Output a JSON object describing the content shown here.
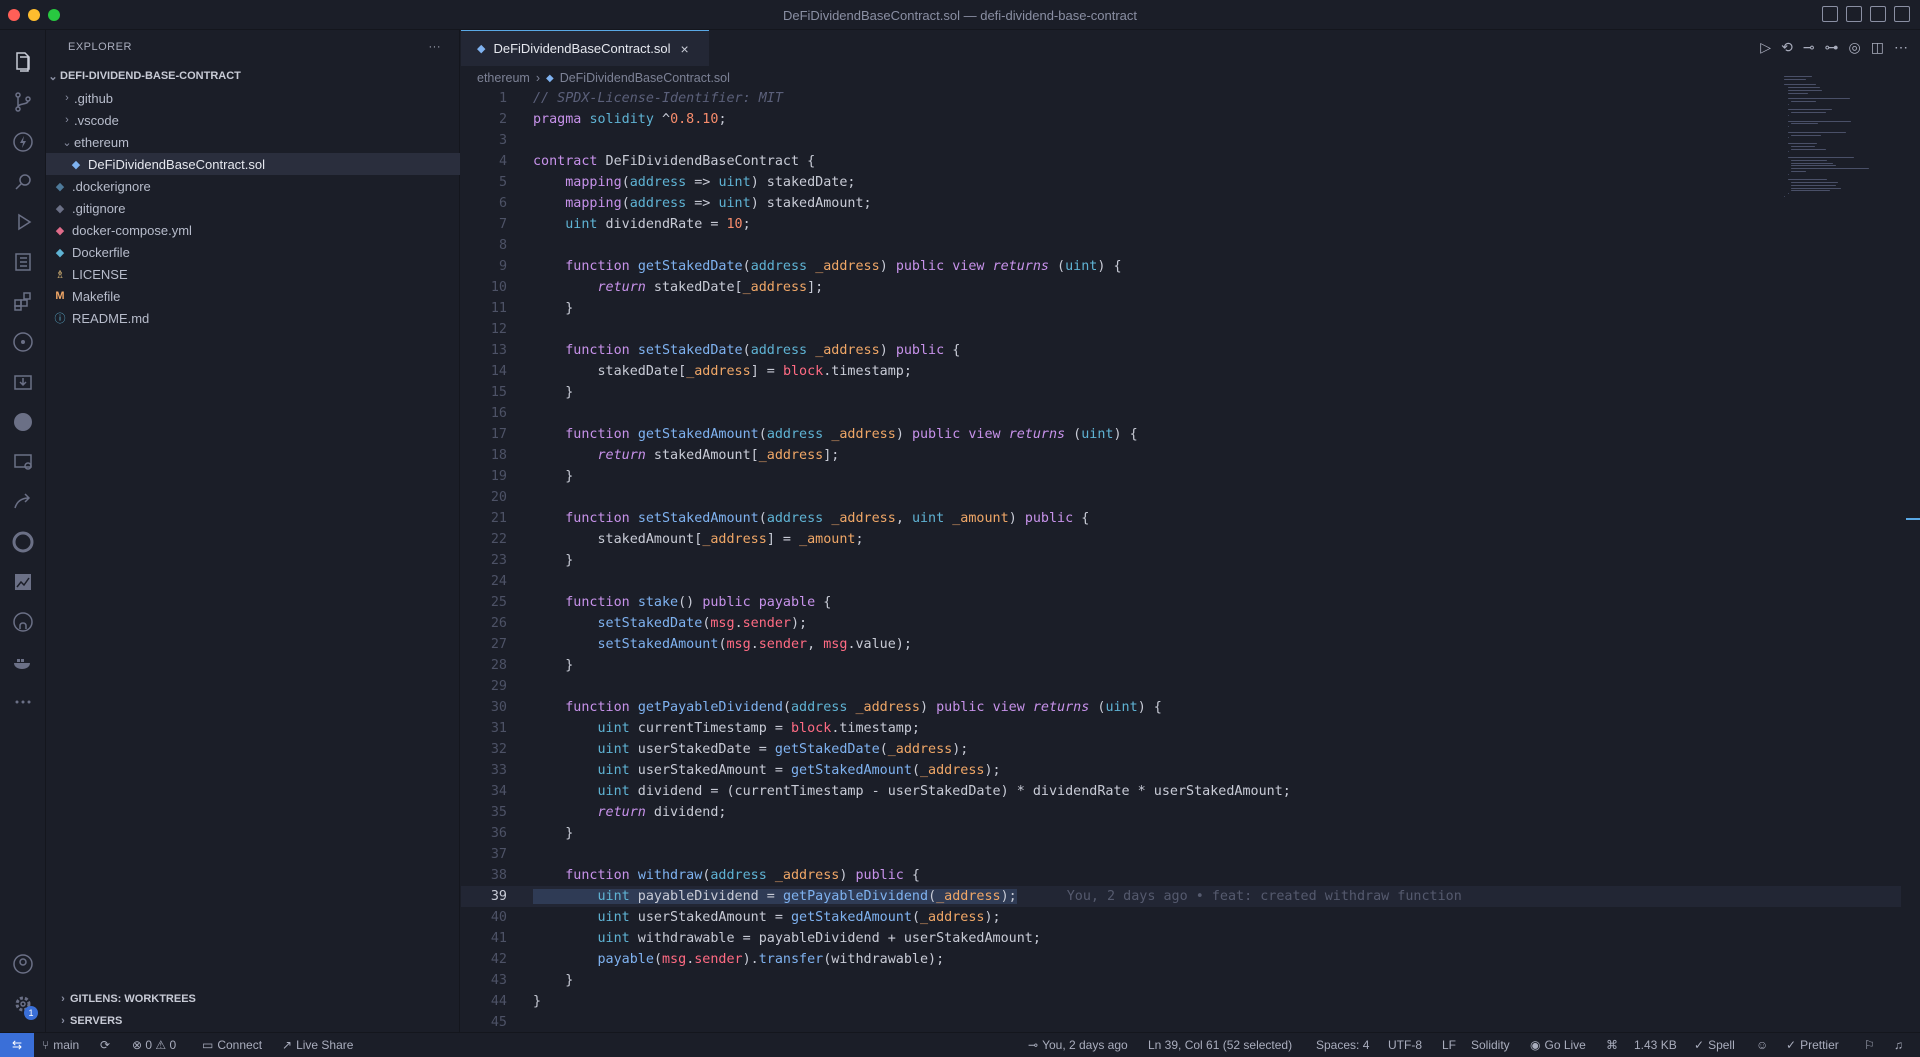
{
  "window": {
    "title": "DeFiDividendBaseContract.sol — defi-dividend-base-contract"
  },
  "explorer": {
    "header": "EXPLORER",
    "more": "···",
    "project": "DEFI-DIVIDEND-BASE-CONTRACT",
    "items": [
      {
        "label": ".github",
        "chev": "›"
      },
      {
        "label": ".vscode",
        "chev": "›"
      },
      {
        "label": "ethereum",
        "chev": "⌄"
      },
      {
        "label": "DeFiDividendBaseContract.sol",
        "icon": "◆"
      },
      {
        "label": ".dockerignore",
        "icon": "◆"
      },
      {
        "label": ".gitignore",
        "icon": "◆"
      },
      {
        "label": "docker-compose.yml",
        "icon": "◆"
      },
      {
        "label": "Dockerfile",
        "icon": "◆"
      },
      {
        "label": "LICENSE",
        "icon": "♗"
      },
      {
        "label": "Makefile",
        "icon": "M"
      },
      {
        "label": "README.md",
        "icon": "ⓘ"
      }
    ],
    "sections": [
      "GITLENS: WORKTREES",
      "SERVERS"
    ]
  },
  "editor": {
    "tab_label": "DeFiDividendBaseContract.sol",
    "tab_close": "×",
    "breadcrumb": [
      "ethereum",
      "DeFiDividendBaseContract.sol"
    ],
    "breadcrumb_sep": "›",
    "blame": "You, 2 days ago • feat: created withdraw function",
    "current_line": 39,
    "lines": [
      "// SPDX-License-Identifier: MIT",
      "pragma solidity ^0.8.10;",
      "",
      "contract DeFiDividendBaseContract {",
      "    mapping(address => uint) stakedDate;",
      "    mapping(address => uint) stakedAmount;",
      "    uint dividendRate = 10;",
      "",
      "    function getStakedDate(address _address) public view returns (uint) {",
      "        return stakedDate[_address];",
      "    }",
      "",
      "    function setStakedDate(address _address) public {",
      "        stakedDate[_address] = block.timestamp;",
      "    }",
      "",
      "    function getStakedAmount(address _address) public view returns (uint) {",
      "        return stakedAmount[_address];",
      "    }",
      "",
      "    function setStakedAmount(address _address, uint _amount) public {",
      "        stakedAmount[_address] = _amount;",
      "    }",
      "",
      "    function stake() public payable {",
      "        setStakedDate(msg.sender);",
      "        setStakedAmount(msg.sender, msg.value);",
      "    }",
      "",
      "    function getPayableDividend(address _address) public view returns (uint) {",
      "        uint currentTimestamp = block.timestamp;",
      "        uint userStakedDate = getStakedDate(_address);",
      "        uint userStakedAmount = getStakedAmount(_address);",
      "        uint dividend = (currentTimestamp - userStakedDate) * dividendRate * userStakedAmount;",
      "        return dividend;",
      "    }",
      "",
      "    function withdraw(address _address) public {",
      "        uint payableDividend = getPayableDividend(_address);",
      "        uint userStakedAmount = getStakedAmount(_address);",
      "        uint withdrawable = payableDividend + userStakedAmount;",
      "        payable(msg.sender).transfer(withdrawable);",
      "    }",
      "}",
      ""
    ]
  },
  "status": {
    "branch": "main",
    "problems": "⊗ 0 ⚠ 0",
    "connect": "Connect",
    "live_share": "Live Share",
    "blame_short": "You, 2 days ago",
    "cursor": "Ln 39, Col 61 (52 selected)",
    "spaces": "Spaces: 4",
    "encoding": "UTF-8",
    "eol": "LF",
    "language": "Solidity",
    "go_live": "Go Live",
    "size": "1.43 KB",
    "spell": "Spell",
    "prettier": "Prettier",
    "badge": "1"
  },
  "colors": {
    "accent": "#3a6fd8",
    "tab_border": "#5aa9e6"
  }
}
